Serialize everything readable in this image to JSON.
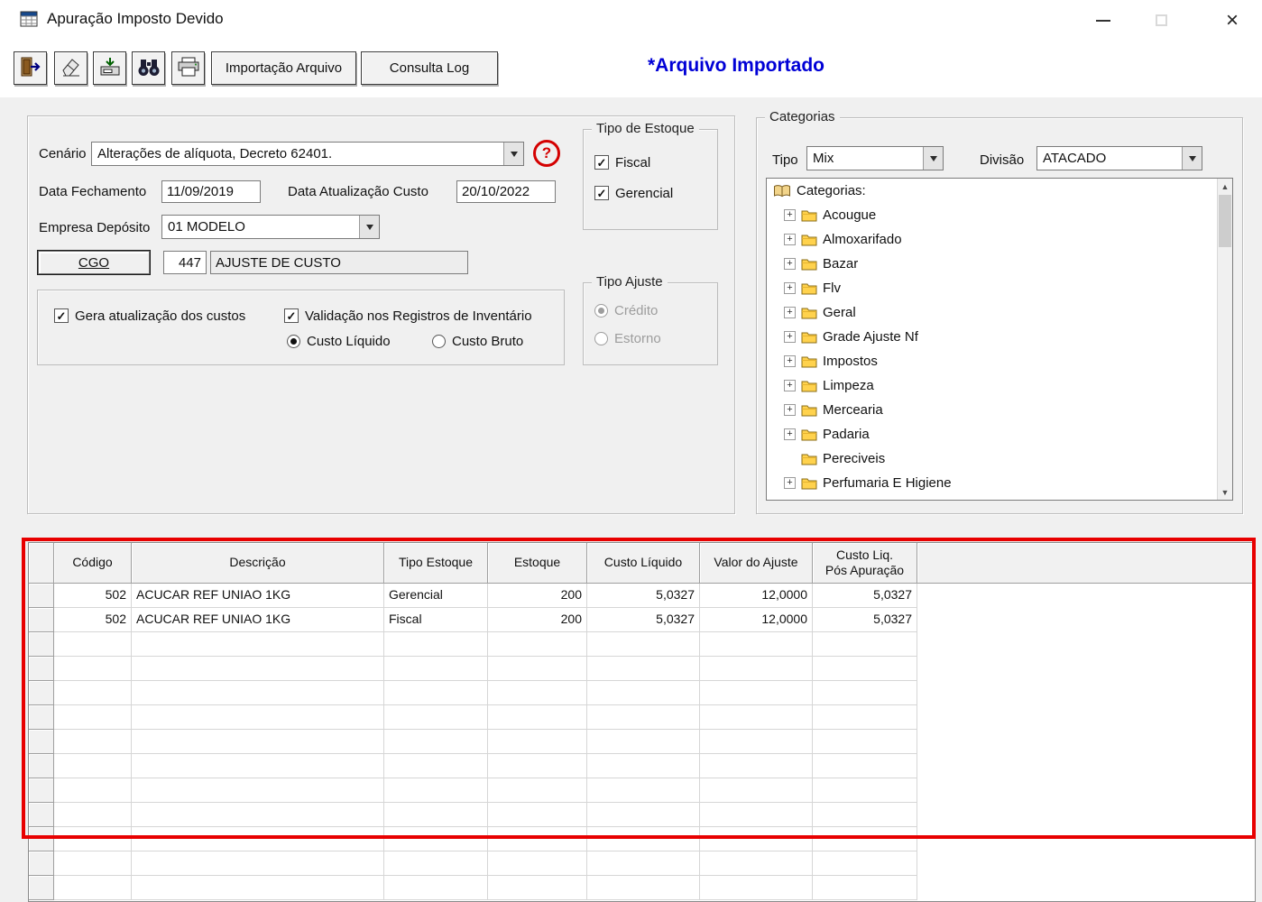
{
  "colors": {
    "status_blue": "#0000d6",
    "annotation_red": "#e80000",
    "help_red": "#d40000",
    "folder_yellow": "#ffd24d"
  },
  "window": {
    "title": "Apuração Imposto Devido"
  },
  "toolbar": {
    "importacao_arquivo": "Importação Arquivo",
    "consulta_log": "Consulta Log",
    "status": "*Arquivo Importado",
    "icon_buttons": [
      "exit-icon",
      "eraser-icon",
      "import-disk-icon",
      "binoculars-icon",
      "printer-icon"
    ]
  },
  "form": {
    "cenario": {
      "label": "Cenário",
      "value": "Alterações de alíquota, Decreto 62401."
    },
    "data_fechamento": {
      "label": "Data Fechamento",
      "value": "11/09/2019"
    },
    "data_atualizacao": {
      "label": "Data Atualização Custo",
      "value": "20/10/2022"
    },
    "empresa_deposito": {
      "label": "Empresa Depósito",
      "value": "01 MODELO"
    },
    "cgo": {
      "button": "CGO",
      "code": "447",
      "descricao": "AJUSTE DE CUSTO"
    },
    "options": {
      "gera_atualizacao": {
        "label": "Gera atualização dos custos",
        "checked": true
      },
      "validacao": {
        "label": "Validação nos Registros de Inventário",
        "checked": true
      },
      "custo_liquido": {
        "label": "Custo Líquido",
        "selected": true
      },
      "custo_bruto": {
        "label": "Custo Bruto",
        "selected": false
      }
    },
    "tipo_estoque": {
      "title": "Tipo de Estoque",
      "fiscal": {
        "label": "Fiscal",
        "checked": true
      },
      "gerencial": {
        "label": "Gerencial",
        "checked": true
      }
    },
    "tipo_ajuste": {
      "title": "Tipo Ajuste",
      "credito": {
        "label": "Crédito",
        "selected": true,
        "enabled": false
      },
      "estorno": {
        "label": "Estorno",
        "selected": false,
        "enabled": false
      }
    }
  },
  "categorias": {
    "title": "Categorias",
    "tipo": {
      "label": "Tipo",
      "value": "Mix"
    },
    "divisao": {
      "label": "Divisão",
      "value": "ATACADO"
    },
    "tree": {
      "root": "Categorias:",
      "items": [
        {
          "label": "Acougue",
          "expandable": true
        },
        {
          "label": "Almoxarifado",
          "expandable": true
        },
        {
          "label": "Bazar",
          "expandable": true
        },
        {
          "label": "Flv",
          "expandable": true
        },
        {
          "label": "Geral",
          "expandable": true
        },
        {
          "label": "Grade Ajuste Nf",
          "expandable": true
        },
        {
          "label": "Impostos",
          "expandable": true
        },
        {
          "label": "Limpeza",
          "expandable": true
        },
        {
          "label": "Mercearia",
          "expandable": true
        },
        {
          "label": "Padaria",
          "expandable": true
        },
        {
          "label": "Pereciveis",
          "expandable": false
        },
        {
          "label": "Perfumaria E Higiene",
          "expandable": true
        }
      ]
    }
  },
  "grid": {
    "columns": [
      "Código",
      "Descrição",
      "Tipo Estoque",
      "Estoque",
      "Custo Líquido",
      "Valor do Ajuste",
      "Custo Liq.\nPós Apuração"
    ],
    "rows": [
      [
        "502",
        "ACUCAR REF UNIAO 1KG",
        "Gerencial",
        "200",
        "5,0327",
        "12,0000",
        "5,0327"
      ],
      [
        "502",
        "ACUCAR REF UNIAO 1KG",
        "Fiscal",
        "200",
        "5,0327",
        "12,0000",
        "5,0327"
      ]
    ]
  }
}
